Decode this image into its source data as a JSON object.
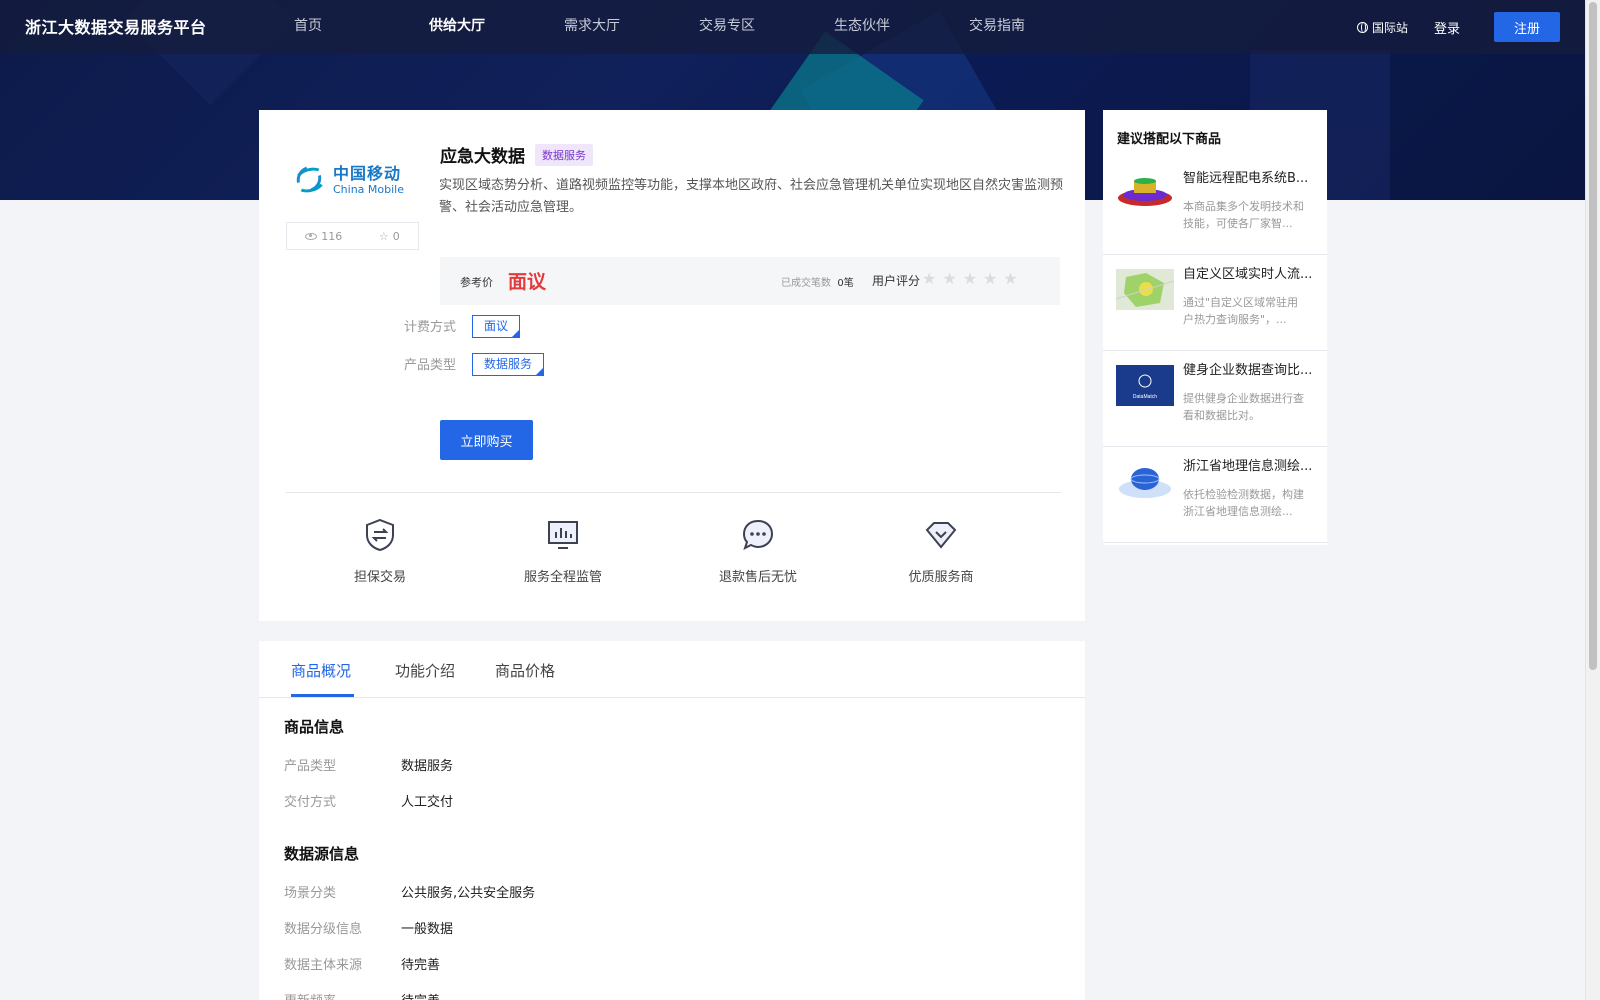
{
  "header": {
    "brand": "浙江大数据交易服务平台",
    "nav": [
      "首页",
      "供给大厅",
      "需求大厅",
      "交易专区",
      "生态伙伴",
      "交易指南"
    ],
    "intl": "国际站",
    "login": "登录",
    "register": "注册"
  },
  "product": {
    "logo_cn": "中国移动",
    "logo_en": "China Mobile",
    "views": "116",
    "favorites": "0",
    "title": "应急大数据",
    "tag": "数据服务",
    "description": "实现区域态势分析、道路视频监控等功能，支撑本地区政府、社会应急管理机关单位实现地区自然灾害监测预警、社会活动应急管理。",
    "price_label": "参考价",
    "price": "面议",
    "deals_label": "已成交笔数",
    "deals_value": "0笔",
    "rating_label": "用户评分",
    "rating": 0,
    "billing_label": "计费方式",
    "billing_value": "面议",
    "type_label": "产品类型",
    "type_value": "数据服务",
    "buy_label": "立即购买"
  },
  "features": [
    {
      "label": "担保交易",
      "icon": "shield-exchange-icon"
    },
    {
      "label": "服务全程监管",
      "icon": "monitor-chart-icon"
    },
    {
      "label": "退款售后无忧",
      "icon": "chat-bubble-icon"
    },
    {
      "label": "优质服务商",
      "icon": "diamond-check-icon"
    }
  ],
  "tabs": [
    "商品概况",
    "功能介绍",
    "商品价格"
  ],
  "product_info": {
    "title": "商品信息",
    "rows": [
      {
        "k": "产品类型",
        "v": "数据服务"
      },
      {
        "k": "交付方式",
        "v": "人工交付"
      }
    ]
  },
  "source_info": {
    "title": "数据源信息",
    "rows": [
      {
        "k": "场景分类",
        "v": "公共服务,公共安全服务"
      },
      {
        "k": "数据分级信息",
        "v": "一般数据"
      },
      {
        "k": "数据主体来源",
        "v": "待完善"
      },
      {
        "k": "更新频率",
        "v": "待完善"
      }
    ]
  },
  "sidebar": {
    "title": "建议搭配以下商品",
    "items": [
      {
        "title": "智能远程配电系统B...",
        "desc": "本商品集多个发明技术和技能，可使各厂家智...",
        "icon": "distribution-3d-icon"
      },
      {
        "title": "自定义区域实时人流...",
        "desc": "通过\"自定义区域常驻用户热力查询服务\"，...",
        "icon": "heatmap-map-icon"
      },
      {
        "title": "健身企业数据查询比...",
        "desc": "提供健身企业数据进行查看和数据比对。",
        "icon": "datamatch-icon",
        "thumb_text": "DataMatch"
      },
      {
        "title": "浙江省地理信息测绘...",
        "desc": "依托检验检测数据，构建浙江省地理信息测绘...",
        "icon": "globe-platform-icon"
      }
    ]
  },
  "colors": {
    "primary": "#2467e6",
    "price": "#e33b3b",
    "tag_bg": "#efe6fb",
    "tag_fg": "#7b35cf"
  }
}
